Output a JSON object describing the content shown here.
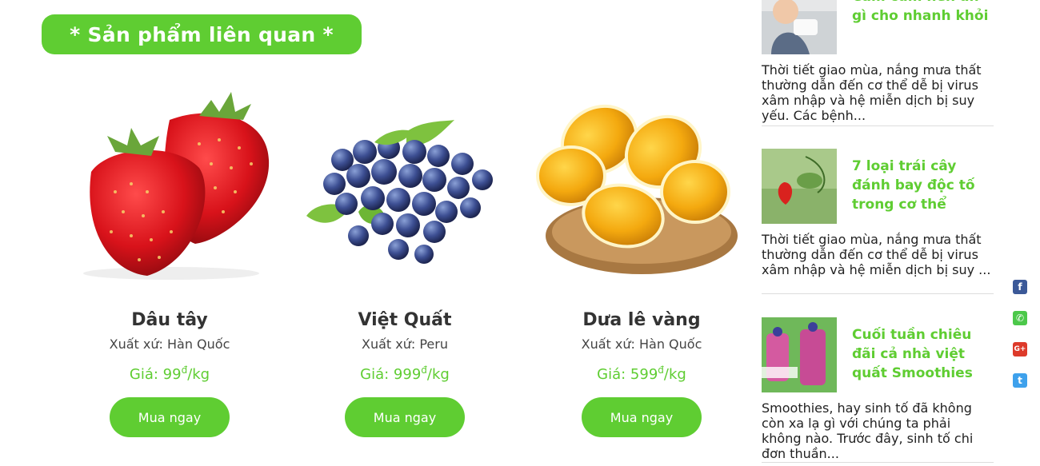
{
  "section": {
    "title": "* Sản phẩm liên quan *"
  },
  "products": [
    {
      "name": "Dâu tây",
      "origin": "Xuất xứ: Hàn Quốc",
      "price_prefix": "Giá: 99",
      "currency": "đ",
      "unit": "/kg",
      "button": "Mua ngay"
    },
    {
      "name": "Việt Quất",
      "origin": "Xuất xứ: Peru",
      "price_prefix": "Giá: 999",
      "currency": "đ",
      "unit": "/kg",
      "button": "Mua ngay"
    },
    {
      "name": "Dưa lê vàng",
      "origin": "Xuất xứ: Hàn Quốc",
      "price_prefix": "Giá: 599",
      "currency": "đ",
      "unit": "/kg",
      "button": "Mua ngay"
    }
  ],
  "sidebar": {
    "news": [
      {
        "title": "Cảm cúm nên ăn gì cho nhanh khỏi",
        "excerpt": "Thời tiết giao mùa, nắng mưa thất thường dẫn đến cơ thể dễ bị virus xâm nhập và hệ miễn dịch bị suy yếu. Các bệnh..."
      },
      {
        "title": "7 loại trái cây đánh bay độc tố trong cơ thể",
        "excerpt": "Thời tiết giao mùa, nắng mưa thất thường dẫn đến cơ thể dễ bị virus xâm nhập và hệ miễn dịch bị suy ..."
      },
      {
        "title": "Cuối tuần chiêu đãi cả nhà việt quất Smoothies",
        "excerpt": "Smoothies, hay sinh tố đã không còn xa lạ gì với chúng ta phải không nào. Trước đây, sinh tố chi đơn thuần..."
      }
    ]
  },
  "social": {
    "icons": [
      {
        "name": "facebook-icon",
        "glyph": "f",
        "color": "#3b5998"
      },
      {
        "name": "phone-icon",
        "glyph": "✆",
        "color": "#4cc84a"
      },
      {
        "name": "google-plus-icon",
        "glyph": "G+",
        "color": "#dd3a2a"
      },
      {
        "name": "twitter-icon",
        "glyph": "t",
        "color": "#3ea1ec"
      }
    ]
  },
  "colors": {
    "accent": "#5fcd32",
    "text": "#222222"
  }
}
